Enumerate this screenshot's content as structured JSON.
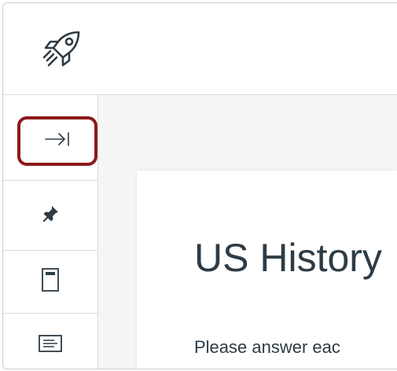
{
  "header": {
    "logo_icon": "rocket-icon"
  },
  "sidebar": {
    "items": [
      {
        "name": "expand-sidebar",
        "icon": "arrow-right-to-bar-icon",
        "glyph": "→|",
        "highlighted": true
      },
      {
        "name": "pin",
        "icon": "pin-icon"
      },
      {
        "name": "question-list",
        "icon": "page-icon"
      },
      {
        "name": "details",
        "icon": "text-lines-icon"
      }
    ]
  },
  "main": {
    "title": "US History",
    "instructions": "Please answer eac"
  },
  "colors": {
    "highlight": "#8b1a1a",
    "text": "#2d3b45",
    "border": "#d7dbde",
    "content_bg": "#f5f5f5"
  }
}
